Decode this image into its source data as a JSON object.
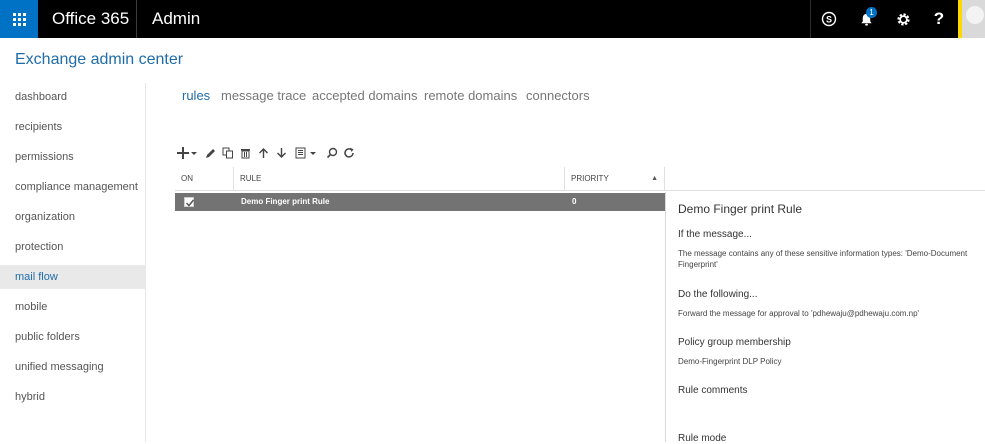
{
  "topbar": {
    "brand": "Office 365",
    "app_name": "Admin",
    "notification_count": "1",
    "help_label": "?",
    "icons": [
      "app-launcher-icon",
      "skype-icon",
      "bell-icon",
      "gear-icon",
      "help-icon",
      "user-avatar-icon"
    ]
  },
  "header": {
    "title": "Exchange admin center"
  },
  "sidebar": {
    "items": [
      {
        "label": "dashboard"
      },
      {
        "label": "recipients"
      },
      {
        "label": "permissions"
      },
      {
        "label": "compliance management"
      },
      {
        "label": "organization"
      },
      {
        "label": "protection"
      },
      {
        "label": "mail flow",
        "active": true
      },
      {
        "label": "mobile"
      },
      {
        "label": "public folders"
      },
      {
        "label": "unified messaging"
      },
      {
        "label": "hybrid"
      }
    ]
  },
  "tabs": [
    {
      "label": "rules",
      "active": true
    },
    {
      "label": "message trace"
    },
    {
      "label": "accepted domains"
    },
    {
      "label": "remote domains"
    },
    {
      "label": "connectors"
    }
  ],
  "toolbar": {
    "tools": [
      "add-icon",
      "edit-icon",
      "copy-icon",
      "delete-icon",
      "move-up-icon",
      "move-down-icon",
      "more-icon",
      "search-icon",
      "refresh-icon"
    ]
  },
  "table": {
    "columns": [
      "ON",
      "RULE",
      "PRIORITY"
    ],
    "rows": [
      {
        "on": true,
        "rule": "Demo Finger print Rule",
        "priority": "0"
      }
    ]
  },
  "details": {
    "title": "Demo Finger print Rule",
    "if_heading": "If the message...",
    "if_text": "The message contains any of these sensitive information types: 'Demo-Document Fingerprint'",
    "do_heading": "Do the following...",
    "do_text": "Forward the message for approval to 'pdhewaju@pdhewaju.com.np'",
    "policy_heading": "Policy group membership",
    "policy_text": "Demo-Fingerprint DLP Policy",
    "comments_heading": "Rule comments",
    "mode_heading": "Rule mode"
  },
  "colors": {
    "accent": "#0072c6",
    "title_blue": "#1f6ca8",
    "topbar": "#000000",
    "selected_row": "#737373",
    "avatar_stripe": "#ffd800"
  }
}
